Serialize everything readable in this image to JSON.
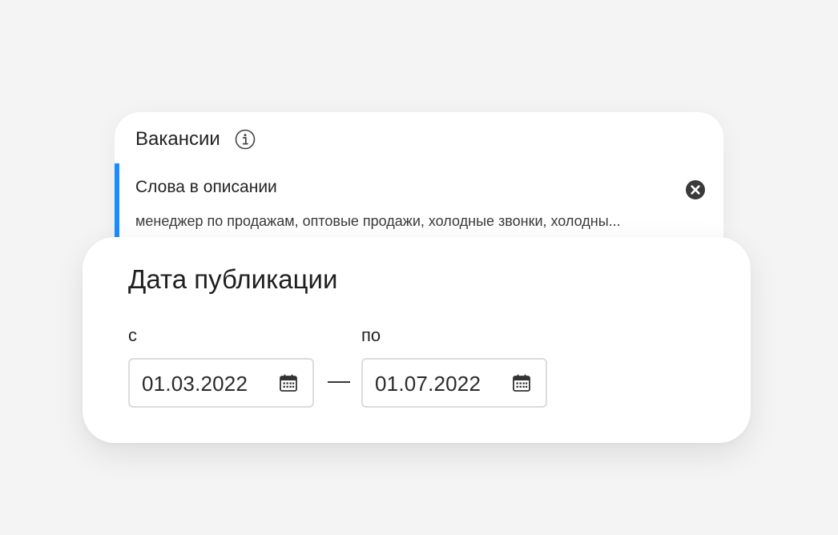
{
  "vacancies_card": {
    "title": "Вакансии",
    "info_icon": "info-icon",
    "filter": {
      "label": "Слова в описании",
      "value": "менеджер по продажам, оптовые продажи, холодные звонки, холодны...",
      "clear_icon": "close-circle-icon",
      "accent_color": "#1a8cff"
    }
  },
  "publication_date_card": {
    "title": "Дата публикации",
    "from": {
      "label": "с",
      "value": "01.03.2022",
      "icon": "calendar-icon"
    },
    "separator": "—",
    "to": {
      "label": "по",
      "value": "01.07.2022",
      "icon": "calendar-icon"
    }
  }
}
